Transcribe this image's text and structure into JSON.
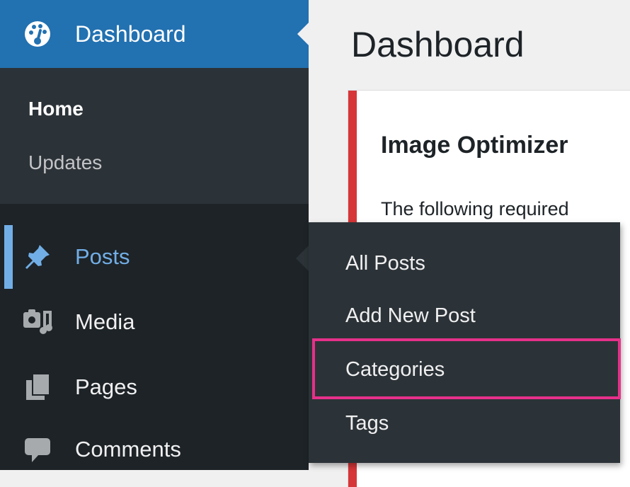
{
  "main": {
    "title": "Dashboard",
    "notice": {
      "title": "Image Optimizer",
      "text": "The following required"
    }
  },
  "sidebar": {
    "dashboard": {
      "label": "Dashboard",
      "icon": "dashboard-gauge-icon"
    },
    "dashboard_submenu": [
      {
        "label": "Home",
        "current": true
      },
      {
        "label": "Updates",
        "current": false
      }
    ],
    "items": [
      {
        "label": "Posts",
        "icon": "pin-icon",
        "active": true
      },
      {
        "label": "Media",
        "icon": "media-icon"
      },
      {
        "label": "Pages",
        "icon": "pages-icon"
      },
      {
        "label": "Comments",
        "icon": "comment-icon"
      }
    ]
  },
  "flyout": {
    "items": [
      {
        "label": "All Posts"
      },
      {
        "label": "Add New Post"
      },
      {
        "label": "Categories",
        "highlighted": true
      },
      {
        "label": "Tags"
      }
    ]
  },
  "colors": {
    "sidebar_bg": "#1d2327",
    "submenu_bg": "#2c3338",
    "accent_blue": "#2271b1",
    "active_text": "#72aee6",
    "notice_border": "#d63638",
    "highlight_box": "#e6308a"
  }
}
